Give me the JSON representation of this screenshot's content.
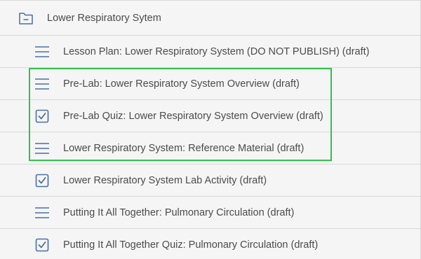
{
  "module": {
    "title": "Lower Respiratory Sytem",
    "icon": "folder-collapse-icon"
  },
  "items": [
    {
      "label": "Lesson Plan: Lower Respiratory System (DO NOT PUBLISH) (draft)",
      "icon": "page-lines-icon"
    },
    {
      "label": "Pre-Lab: Lower Respiratory System Overview (draft)",
      "icon": "page-lines-icon"
    },
    {
      "label": "Pre-Lab Quiz: Lower Respiratory System Overview (draft)",
      "icon": "quiz-checkbox-icon"
    },
    {
      "label": "Lower Respiratory System: Reference Material (draft)",
      "icon": "page-lines-icon"
    },
    {
      "label": "Lower Respiratory System Lab Activity (draft)",
      "icon": "quiz-checkbox-icon"
    },
    {
      "label": "Putting It All Together: Pulmonary Circulation (draft)",
      "icon": "page-lines-icon"
    },
    {
      "label": "Putting It All Together Quiz: Pulmonary Circulation (draft)",
      "icon": "quiz-checkbox-icon"
    }
  ],
  "colors": {
    "icon": "#4a6fa5",
    "text": "#4b4b4b",
    "row_background": "#f5f5f5",
    "divider": "#d9d9d9",
    "highlight": "#2fc14b"
  }
}
